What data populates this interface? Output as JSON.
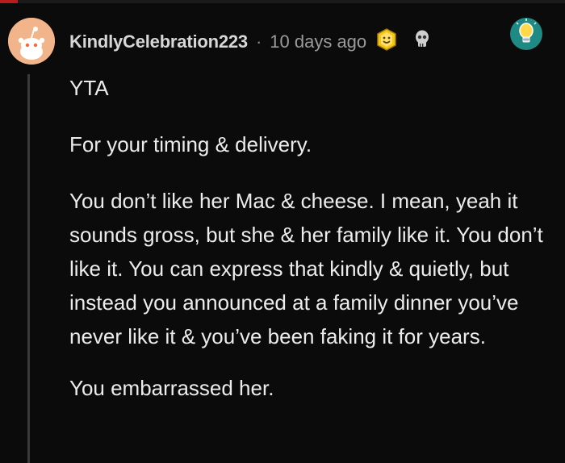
{
  "comment": {
    "username": "KindlyCelebration223",
    "separator": "·",
    "timestamp": "10 days ago",
    "paragraphs": {
      "p1": "YTA",
      "p2": "For your timing & delivery.",
      "p3": "You don’t like her Mac & cheese. I mean, yeah it sounds gross, but she & her family like it. You don’t like it. You can express that kindly & quietly, but instead you announced at a family dinner you’ve never like it & you’ve been faking it for years.",
      "p4": "You embarrassed her."
    },
    "awards": [
      "smiling-face-award-icon",
      "skull-award-icon"
    ],
    "corner_icon": "lightbulb-icon"
  },
  "colors": {
    "background": "#0b0b0b",
    "text": "#ececec",
    "username": "#d7d7d7",
    "meta": "#9b9b9b",
    "thread_line": "#3a3a3a",
    "avatar_bg": "#f2b48a",
    "lightbulb_bg": "#1f8a84"
  }
}
